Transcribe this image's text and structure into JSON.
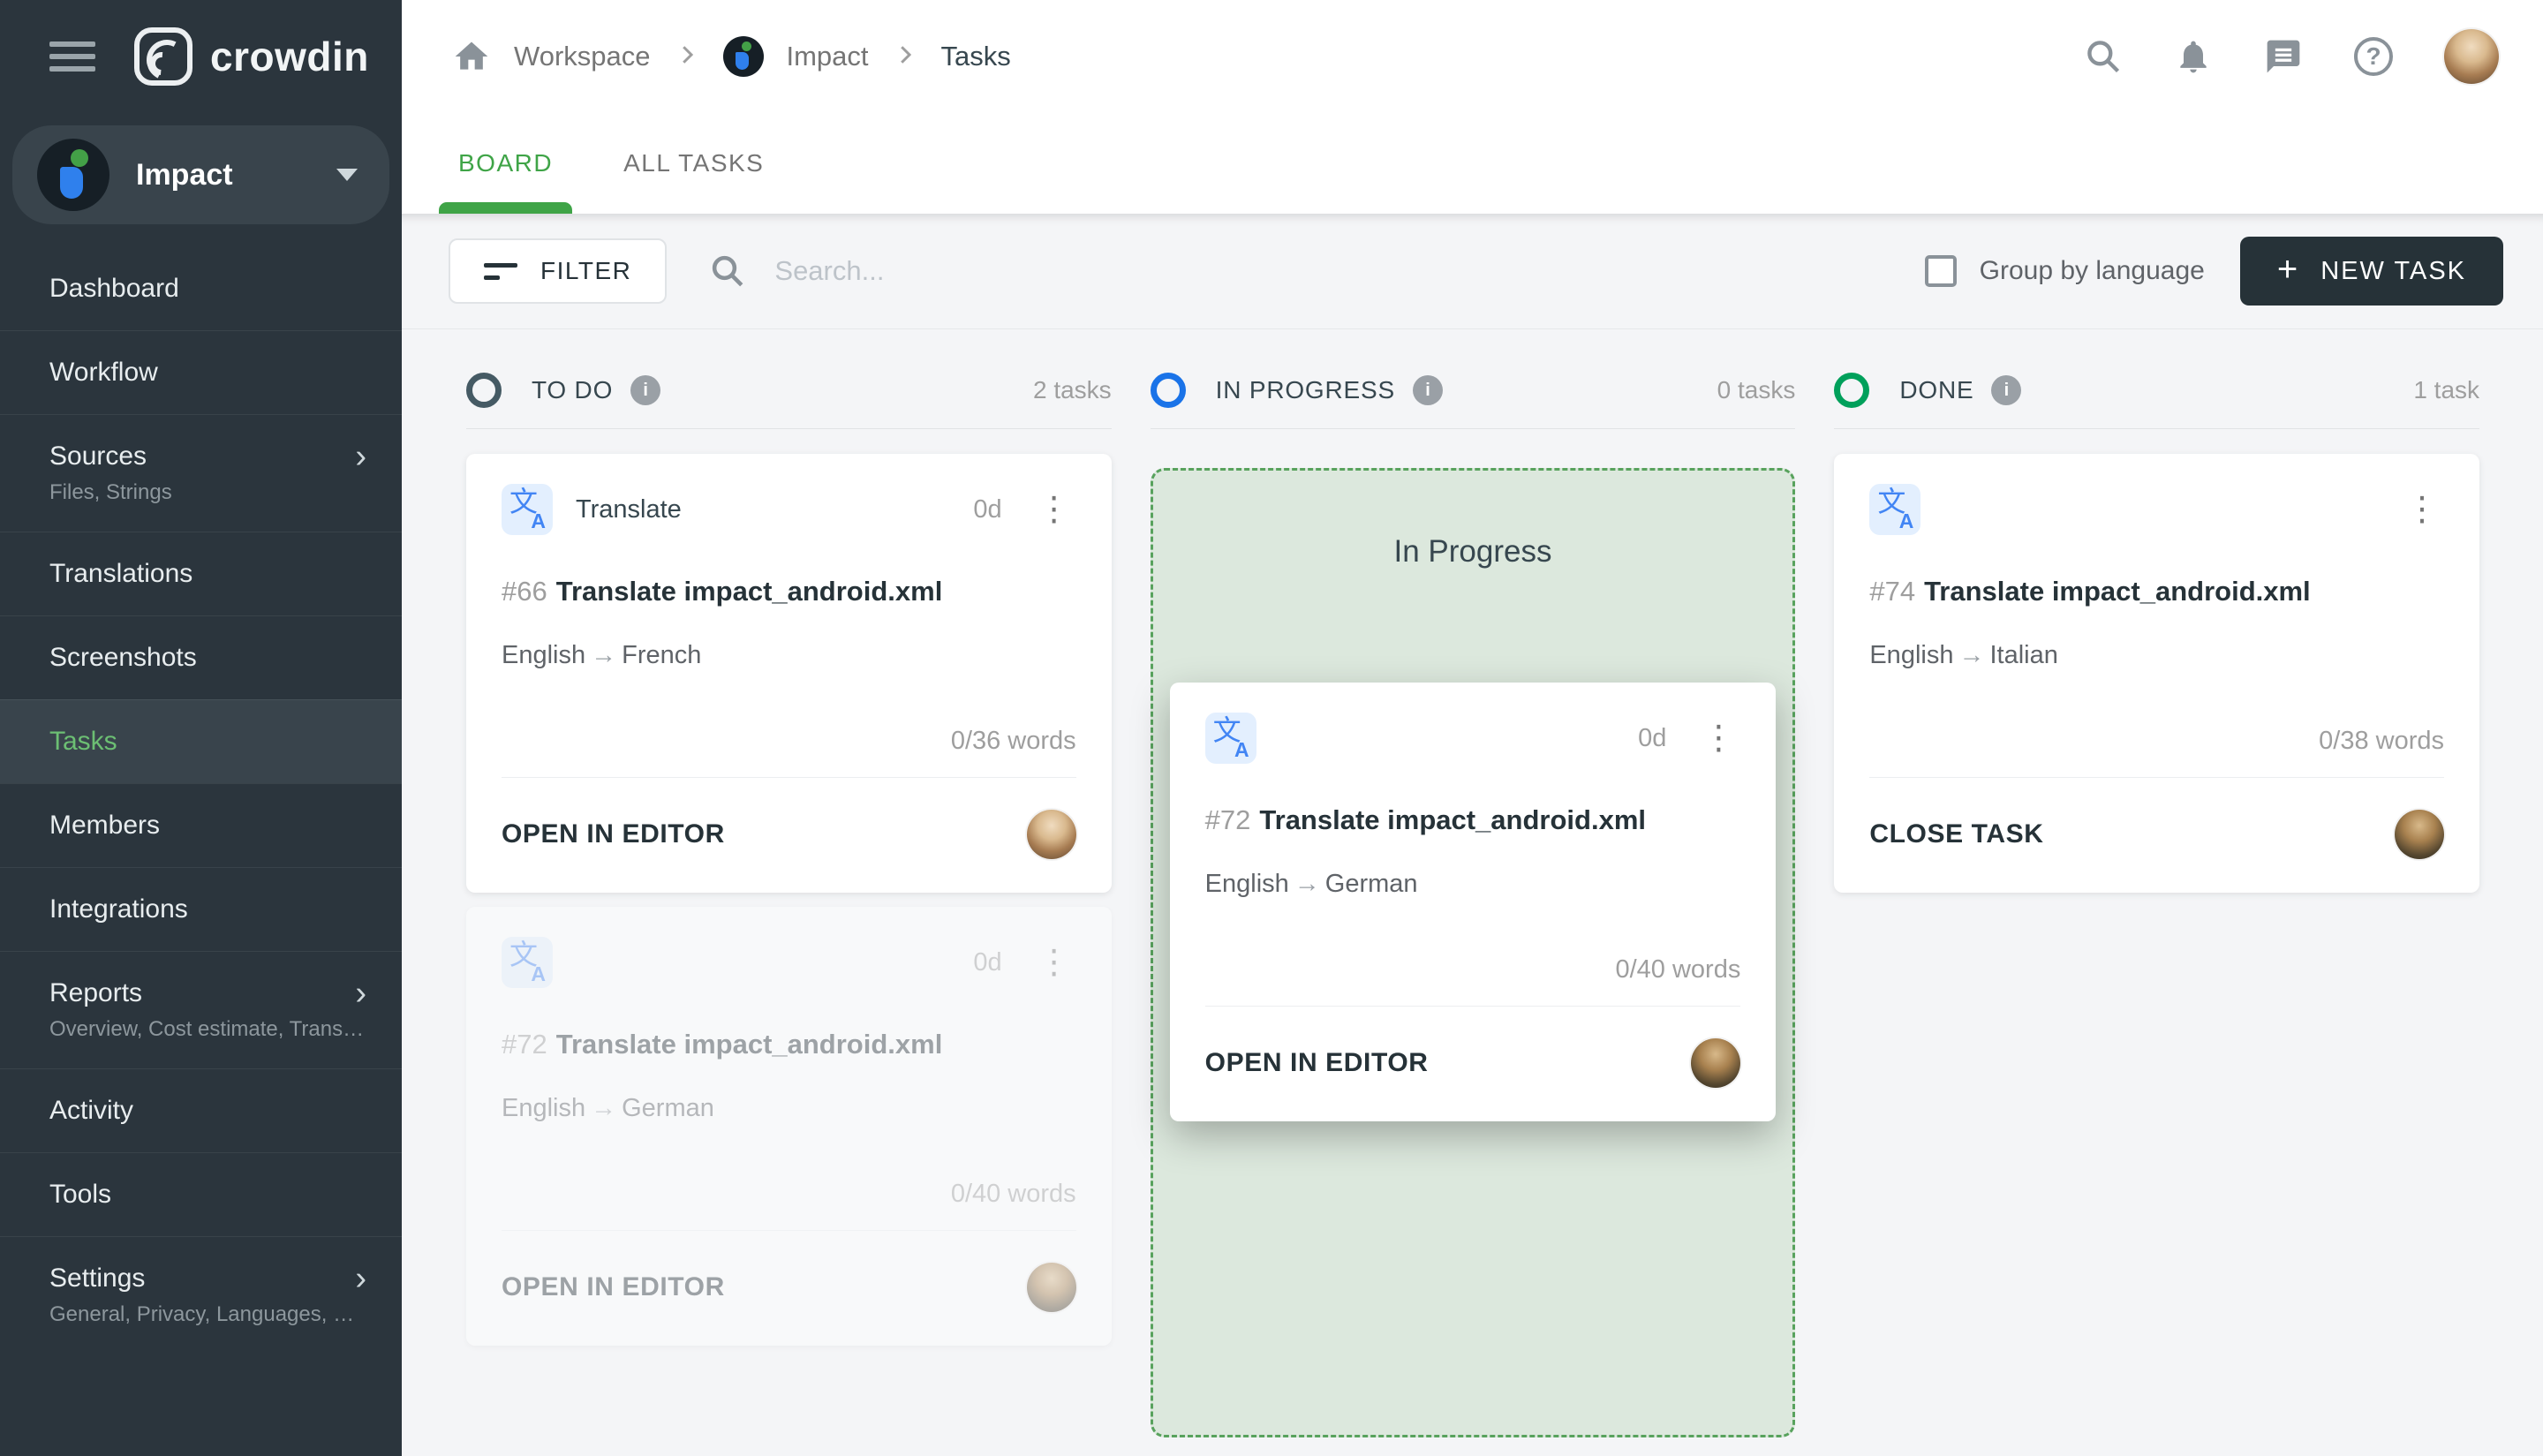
{
  "app": {
    "logo_text": "crowdin"
  },
  "colors": {
    "sidebar_bg": "#2b353d",
    "accent_green": "#3fa447",
    "sidebar_active_green": "#6cbf73",
    "todo_status": "#455a64",
    "in_progress_status": "#1a73e8",
    "done_status": "#00a05b",
    "new_task_bg": "#263238",
    "dropzone_bg": "#dce8dd",
    "dropzone_border": "#58a25d"
  },
  "header": {
    "breadcrumb": {
      "workspace": "Workspace",
      "project": "Impact",
      "page": "Tasks"
    },
    "icons": [
      "search-icon",
      "bell-icon",
      "chat-icon",
      "help-icon",
      "avatar"
    ]
  },
  "tabs": [
    {
      "label": "BOARD",
      "active": true
    },
    {
      "label": "ALL TASKS",
      "active": false
    }
  ],
  "toolbar": {
    "filter_label": "FILTER",
    "search_placeholder": "Search...",
    "group_by_label": "Group by language",
    "new_task_label": "NEW TASK",
    "new_task_plus": "+"
  },
  "sidebar": {
    "project_name": "Impact",
    "items": [
      {
        "label": "Dashboard"
      },
      {
        "label": "Workflow"
      },
      {
        "label": "Sources",
        "sub": "Files, Strings",
        "chevron": true
      },
      {
        "label": "Translations"
      },
      {
        "label": "Screenshots"
      },
      {
        "label": "Tasks",
        "active": true
      },
      {
        "label": "Members"
      },
      {
        "label": "Integrations"
      },
      {
        "label": "Reports",
        "sub": "Overview, Cost estimate, Transl…",
        "chevron": true
      },
      {
        "label": "Activity"
      },
      {
        "label": "Tools"
      },
      {
        "label": "Settings",
        "sub": "General, Privacy, Languages, Q…",
        "chevron": true
      }
    ]
  },
  "board": {
    "columns": [
      {
        "name": "TO DO",
        "count": "2 tasks",
        "status_color": "#455a64",
        "info": false,
        "cards": [
          {
            "number": "#66",
            "title": "Translate impact_android.xml",
            "badge": "Translate",
            "days": "0d",
            "languages": [
              "English",
              "French"
            ],
            "words": "0/36 words",
            "action": "OPEN IN EDITOR",
            "avatar": "user1",
            "ghost": false
          },
          {
            "number": "#72",
            "title": "Translate impact_android.xml",
            "badge": null,
            "days": "0d",
            "languages": [
              "English",
              "German"
            ],
            "words": "0/40 words",
            "action": "OPEN IN EDITOR",
            "avatar": "user2",
            "ghost": true
          }
        ]
      },
      {
        "name": "IN PROGRESS",
        "count": "0 tasks",
        "status_color": "#1a73e8",
        "info": false,
        "cards": [],
        "dropzone": {
          "label": "In Progress",
          "card": {
            "number": "#72",
            "title": "Translate impact_android.xml",
            "badge": null,
            "days": "0d",
            "languages": [
              "English",
              "German"
            ],
            "words": "0/40 words",
            "action": "OPEN IN EDITOR",
            "avatar": "user2",
            "elevated": true
          }
        }
      },
      {
        "name": "DONE",
        "count": "1 task",
        "status_color": "#00a05b",
        "info": true,
        "cards": [
          {
            "number": "#74",
            "title": "Translate impact_android.xml",
            "badge": null,
            "days": null,
            "languages": [
              "English",
              "Italian"
            ],
            "words": "0/38 words",
            "action": "CLOSE TASK",
            "avatar": "user2",
            "ghost": false
          }
        ]
      }
    ],
    "lang_arrow": "→"
  }
}
